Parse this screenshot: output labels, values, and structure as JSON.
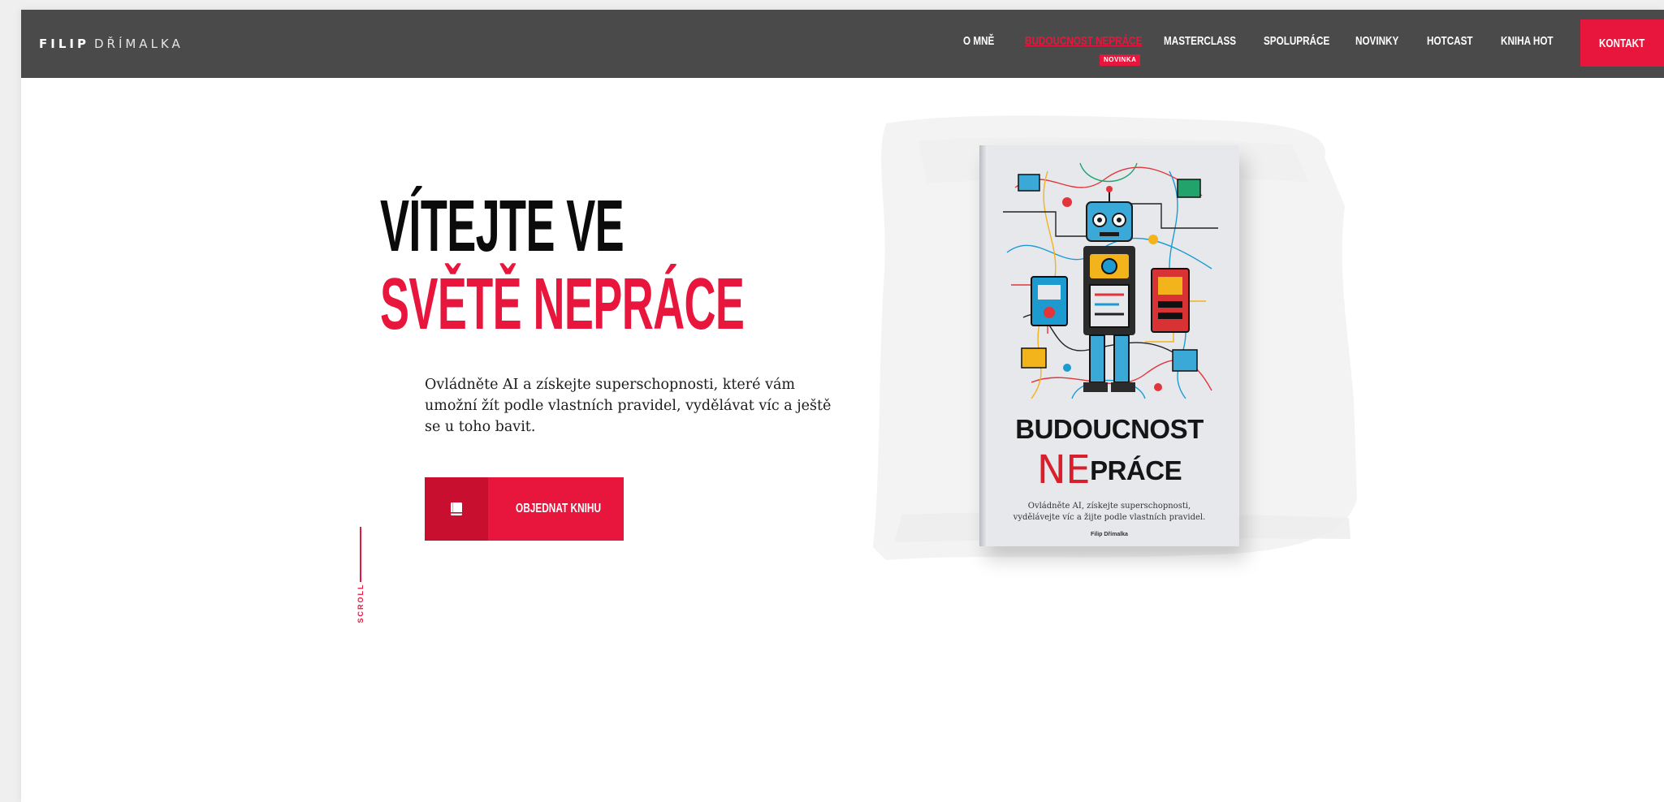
{
  "header": {
    "brand_first": "FILIP",
    "brand_last": "DŘÍMALKA",
    "nav": [
      {
        "label": "O MNĚ"
      },
      {
        "label": "BUDOUCNOST NEPRÁCE",
        "active": true,
        "badge": "NOVINKA"
      },
      {
        "label": "MASTERCLASS"
      },
      {
        "label": "SPOLUPRÁCE"
      },
      {
        "label": "NOVINKY"
      },
      {
        "label": "HOTCAST"
      },
      {
        "label": "KNIHA HOT"
      }
    ],
    "contact_label": "KONTAKT"
  },
  "hero": {
    "title_line_1": "VÍTEJTE VE",
    "title_line_2": "SVĚTĚ NEPRÁCE",
    "subtitle": "Ovládněte AI a získejte superschopnosti, které vám umožní žít podle vlastních pravidel, vydělávat víc a ještě se u toho bavit.",
    "cta_label": "OBJEDNAT KNIHU",
    "cta_icon": "book-icon",
    "scroll_label": "SCROLL"
  },
  "book": {
    "title_line_1": "BUDOUCNOST",
    "title_ne": "NE",
    "title_rest": "PRÁCE",
    "blurb": "Ovládněte AI, získejte superschopnosti, vydělávejte víc a žijte podle vlastních pravidel.",
    "author": "Filip Dřímalka"
  },
  "colors": {
    "accent": "#e8163c",
    "accent_dark": "#c80f30",
    "header_bg": "#4a4a4a",
    "text_dark": "#0b0b0b"
  }
}
